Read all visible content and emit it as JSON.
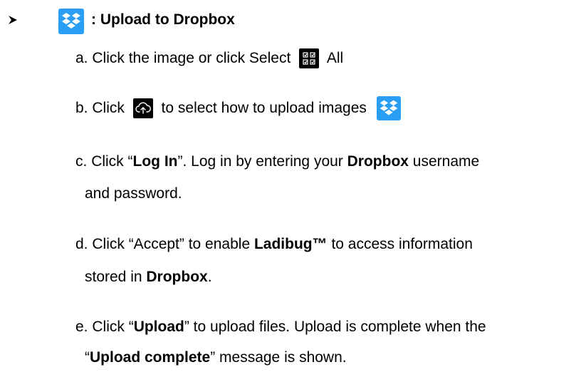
{
  "section": {
    "bullet_icon": "arrow-bullet-icon",
    "title_icon": "dropbox-icon",
    "title": ": Upload to Dropbox"
  },
  "steps": {
    "a": {
      "marker": "a.",
      "text_before": "Click the image or click Select",
      "icon": "select-all-icon",
      "text_after": "All"
    },
    "b": {
      "marker": "b.",
      "text_before": "Click",
      "icon": "cloud-upload-icon",
      "text_after": "to select how to upload images",
      "icon_end": "dropbox-icon"
    },
    "c": {
      "marker": "c.",
      "t1": "Click “",
      "b1": "Log In",
      "t2": "”. Log in by entering your ",
      "b2": "Dropbox",
      "t3": " username",
      "line2": "and password."
    },
    "d": {
      "marker": "d.",
      "t1": "Click “Accept” to enable ",
      "b1": "Ladibug™",
      "t2": " to access information",
      "line2_t1": "stored in ",
      "line2_b1": "Dropbox",
      "line2_t2": "."
    },
    "e": {
      "marker": "e.",
      "t1": "Click “",
      "b1": "Upload",
      "t2": "” to upload files. Upload is complete when the",
      "line2_t1": "“",
      "line2_b1": "Upload complete",
      "line2_t2": "” message is shown."
    }
  },
  "colors": {
    "dropbox_blue": "#2a9df4",
    "icon_dark": "#000000"
  }
}
